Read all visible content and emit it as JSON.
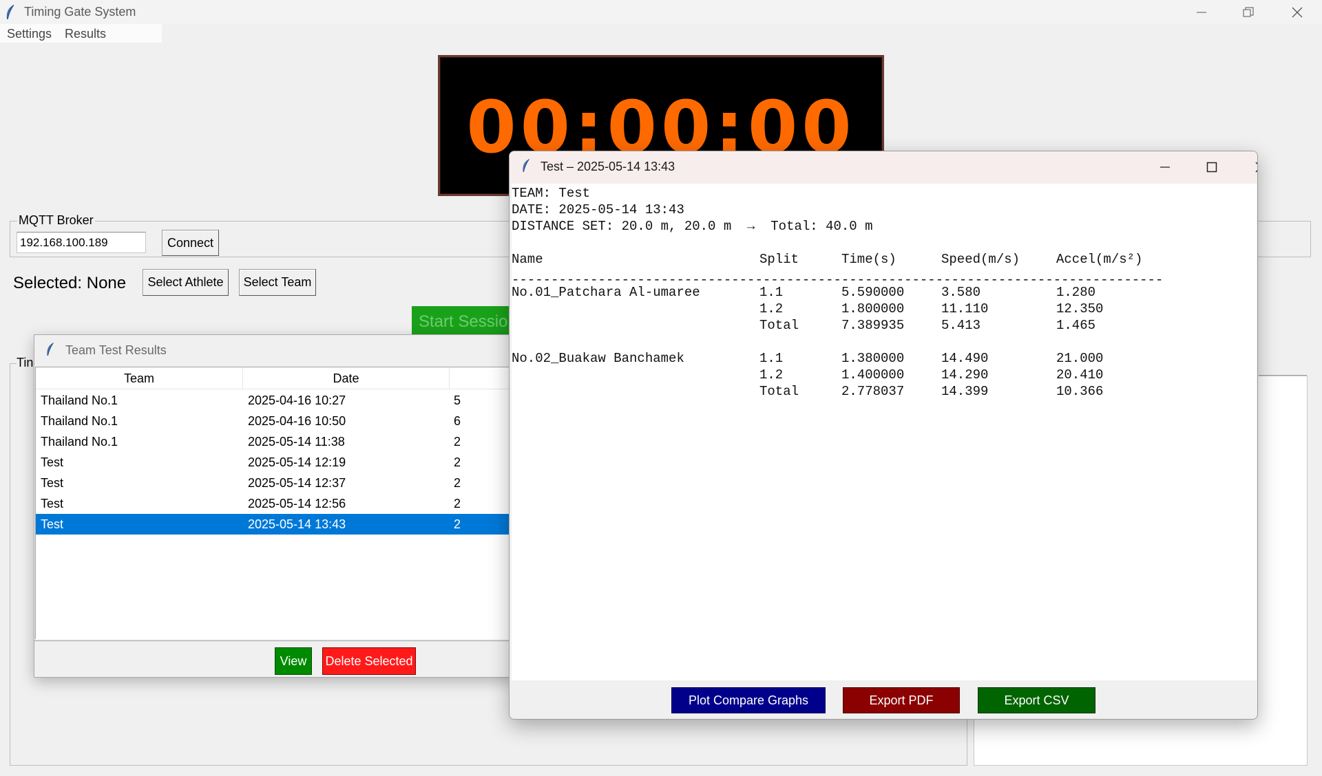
{
  "main_window": {
    "title": "Timing Gate System",
    "menu": [
      "Settings",
      "Results"
    ]
  },
  "timer": {
    "display": "00:00:00",
    "color": "#ff6a00"
  },
  "mqtt": {
    "legend": "MQTT Broker",
    "ip_value": "192.168.100.189",
    "connect_label": "Connect"
  },
  "selection": {
    "label": "Selected: None",
    "select_athlete_label": "Select Athlete",
    "select_team_label": "Select Team",
    "start_session_label": "Start Session"
  },
  "timing_frame": {
    "legend_partial": "Tin"
  },
  "team_results": {
    "title": "Team Test Results",
    "columns": [
      "Team",
      "Date"
    ],
    "rows": [
      {
        "team": "Thailand No.1",
        "date": "2025-04-16 10:27",
        "count": "5",
        "selected": false
      },
      {
        "team": "Thailand No.1",
        "date": "2025-04-16 10:50",
        "count": "6",
        "selected": false
      },
      {
        "team": "Thailand No.1",
        "date": "2025-05-14 11:38",
        "count": "2",
        "selected": false
      },
      {
        "team": "Test",
        "date": "2025-05-14 12:19",
        "count": "2",
        "selected": false
      },
      {
        "team": "Test",
        "date": "2025-05-14 12:37",
        "count": "2",
        "selected": false
      },
      {
        "team": "Test",
        "date": "2025-05-14 12:56",
        "count": "2",
        "selected": false
      },
      {
        "team": "Test",
        "date": "2025-05-14 13:43",
        "count": "2",
        "selected": true
      }
    ],
    "view_label": "View",
    "delete_label": "Delete Selected",
    "view_color": "#008a00",
    "delete_color": "#ff1a1a",
    "selected_row_color": "#0078d7"
  },
  "test_detail": {
    "title": "Test – 2025-05-14 13:43",
    "team_line": "TEAM: Test",
    "date_line": "DATE: 2025-05-14 13:43",
    "distance_line": "DISTANCE SET: 20.0 m, 20.0 m  →  Total: 40.0 m",
    "headers": {
      "name": "Name",
      "split": "Split",
      "time": "Time(s)",
      "speed": "Speed(m/s)",
      "accel": "Accel(m/s²)"
    },
    "separator": "-----------------------------------------------------------------------------------",
    "athletes": [
      {
        "name": "No.01_Patchara Al-umaree",
        "splits": [
          {
            "split": "1.1",
            "time": "5.590000",
            "speed": "3.580",
            "accel": "1.280"
          },
          {
            "split": "1.2",
            "time": "1.800000",
            "speed": "11.110",
            "accel": "12.350"
          },
          {
            "split": "Total",
            "time": "7.389935",
            "speed": "5.413",
            "accel": "1.465"
          }
        ]
      },
      {
        "name": "No.02_Buakaw Banchamek",
        "splits": [
          {
            "split": "1.1",
            "time": "1.380000",
            "speed": "14.490",
            "accel": "21.000"
          },
          {
            "split": "1.2",
            "time": "1.400000",
            "speed": "14.290",
            "accel": "20.410"
          },
          {
            "split": "Total",
            "time": "2.778037",
            "speed": "14.399",
            "accel": "10.366"
          }
        ]
      }
    ],
    "plot_label": "Plot Compare Graphs",
    "pdf_label": "Export PDF",
    "csv_label": "Export CSV",
    "plot_color": "#00008b",
    "pdf_color": "#8b0000",
    "csv_color": "#006400"
  }
}
